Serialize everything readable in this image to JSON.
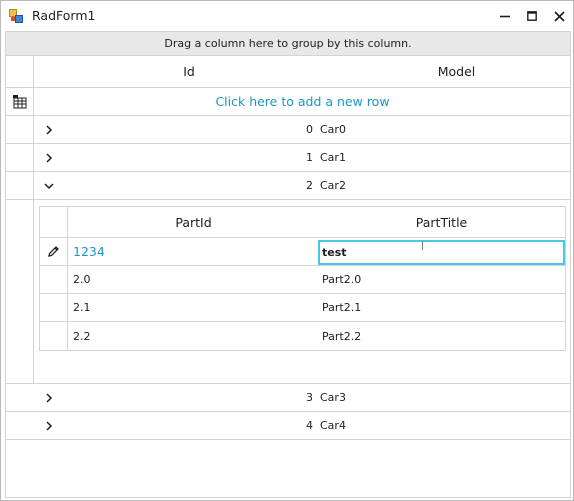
{
  "window": {
    "title": "RadForm1"
  },
  "grid": {
    "group_panel_text": "Drag a column here to group by this column.",
    "columns": [
      "Id",
      "Model"
    ],
    "new_row_text": "Click here to add a new row",
    "rows": [
      {
        "id": "0",
        "model": "Car0",
        "expanded": false
      },
      {
        "id": "1",
        "model": "Car1",
        "expanded": false
      },
      {
        "id": "2",
        "model": "Car2",
        "expanded": true
      },
      {
        "id": "3",
        "model": "Car3",
        "expanded": false
      },
      {
        "id": "4",
        "model": "Car4",
        "expanded": false
      }
    ]
  },
  "child_grid": {
    "columns": [
      "PartId",
      "PartTitle"
    ],
    "edit_row": {
      "part_id": "1234",
      "part_title": "test"
    },
    "rows": [
      {
        "part_id": "2.0",
        "part_title": "Part2.0"
      },
      {
        "part_id": "2.1",
        "part_title": "Part2.1"
      },
      {
        "part_id": "2.2",
        "part_title": "Part2.2"
      }
    ]
  },
  "icons": {
    "app": "radform-app-icon",
    "new_row": "table-add-icon",
    "edit": "pencil-icon",
    "collapsed": "chevron-right-icon",
    "expanded": "chevron-down-icon"
  },
  "colors": {
    "link": "#1b97c6",
    "focus_border": "#47c8e6",
    "grid_line": "#d4d4d4",
    "group_panel_bg": "#e8e8e8"
  }
}
